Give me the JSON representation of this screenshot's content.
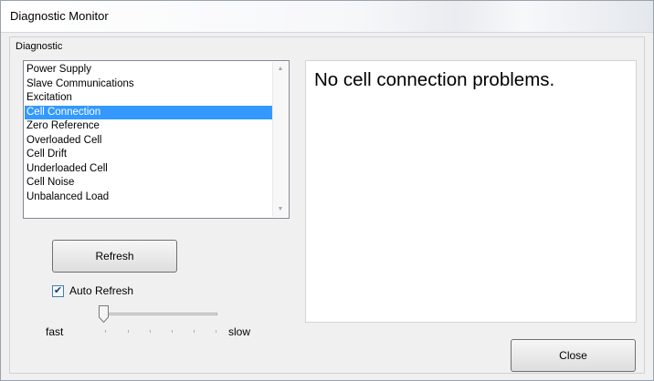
{
  "window": {
    "title": "Diagnostic Monitor"
  },
  "group": {
    "label": "Diagnostic"
  },
  "diagnostics": {
    "items": [
      "Power Supply",
      "Slave Communications",
      "Excitation",
      "Cell Connection",
      "Zero Reference",
      "Overloaded Cell",
      "Cell Drift",
      "Underloaded Cell",
      "Cell Noise",
      "Unbalanced Load"
    ],
    "selected_item": "Cell Connection"
  },
  "result": {
    "message": "No cell connection problems."
  },
  "refresh_button": {
    "label": "Refresh"
  },
  "auto_refresh": {
    "label": "Auto Refresh",
    "checked": true
  },
  "speed_slider": {
    "min_label": "fast",
    "max_label": "slow",
    "level": 0
  },
  "close_button": {
    "label": "Close"
  },
  "colors": {
    "selection": "#3399ff",
    "window_bg": "#f0f0f0"
  }
}
